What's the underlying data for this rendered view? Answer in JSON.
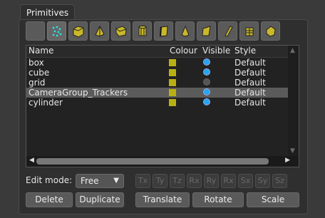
{
  "panel": {
    "title": "Primitives"
  },
  "toolbar": {
    "tools": [
      {
        "icon": "blank-tool-icon"
      },
      {
        "icon": "tracker-points-icon"
      },
      {
        "icon": "box-mesh-icon"
      },
      {
        "icon": "pyramid-mesh-icon"
      },
      {
        "icon": "cube-mesh-icon"
      },
      {
        "icon": "cylinder-mesh-icon"
      },
      {
        "icon": "plane-mesh-icon"
      },
      {
        "icon": "cone-mesh-icon"
      },
      {
        "icon": "wedge-mesh-icon"
      },
      {
        "icon": "card-mesh-icon"
      },
      {
        "icon": "drum-mesh-icon"
      },
      {
        "icon": "rock-mesh-icon"
      }
    ]
  },
  "table": {
    "headers": {
      "name": "Name",
      "colour": "Colour",
      "visible": "Visible",
      "style": "Style"
    },
    "rows": [
      {
        "name": "box",
        "style": "Default",
        "visible": true,
        "selected": false
      },
      {
        "name": "cube",
        "style": "Default",
        "visible": true,
        "selected": false
      },
      {
        "name": "grid",
        "style": "Default",
        "visible": false,
        "selected": false
      },
      {
        "name": "CameraGroup_Trackers",
        "style": "Default",
        "visible": true,
        "selected": true
      },
      {
        "name": "cylinder",
        "style": "Default",
        "visible": true,
        "selected": false
      }
    ]
  },
  "edit": {
    "label": "Edit mode:",
    "mode": "Free"
  },
  "axes": [
    "Tx",
    "Ty",
    "Tz",
    "Rx",
    "Ry",
    "Rx",
    "Sx",
    "Sy",
    "Sz"
  ],
  "buttons": {
    "delete": "Delete",
    "duplicate": "Duplicate",
    "translate": "Translate",
    "rotate": "Rotate",
    "scale": "Scale"
  },
  "colors": {
    "swatch": "#b9b014",
    "visible_on": "#28a4f0",
    "mesh": "#c9b82a"
  }
}
